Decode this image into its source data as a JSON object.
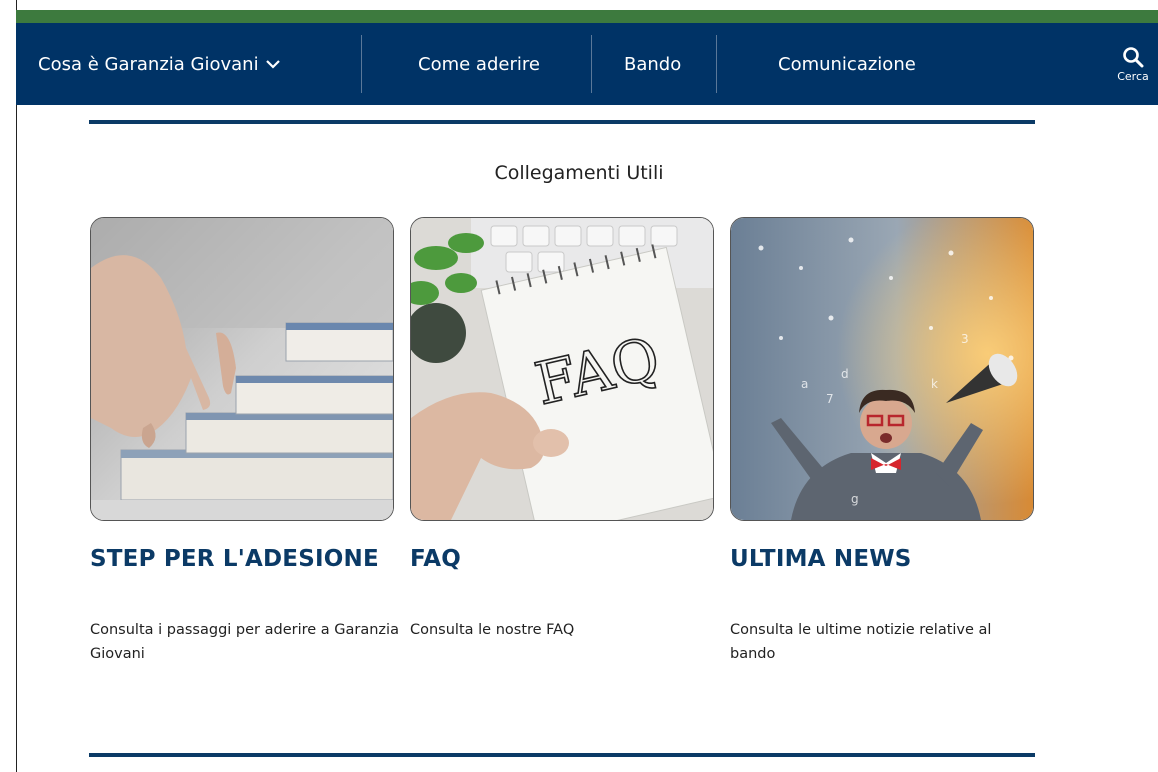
{
  "nav": {
    "items": [
      {
        "label": "Cosa è Garanzia Giovani"
      },
      {
        "label": "Come aderire"
      },
      {
        "label": "Bando"
      },
      {
        "label": "Comunicazione"
      }
    ],
    "search_label": "Cerca"
  },
  "section": {
    "title": "Collegamenti Utili"
  },
  "cards": [
    {
      "title": "STEP PER L'ADESIONE",
      "description": "Consulta i passaggi per aderire a Garanzia Giovani",
      "image": "hand-climbing-books"
    },
    {
      "title": "FAQ",
      "description": "Consulta le nostre FAQ",
      "image": "faq-notepad",
      "image_text": "FAQ"
    },
    {
      "title": "ULTIMA NEWS",
      "description": "Consulta le ultime notizie relative al bando",
      "image": "man-with-megaphone"
    }
  ],
  "colors": {
    "green_bar": "#3d7a3e",
    "navbar": "#003366",
    "accent": "#0b3a66"
  }
}
